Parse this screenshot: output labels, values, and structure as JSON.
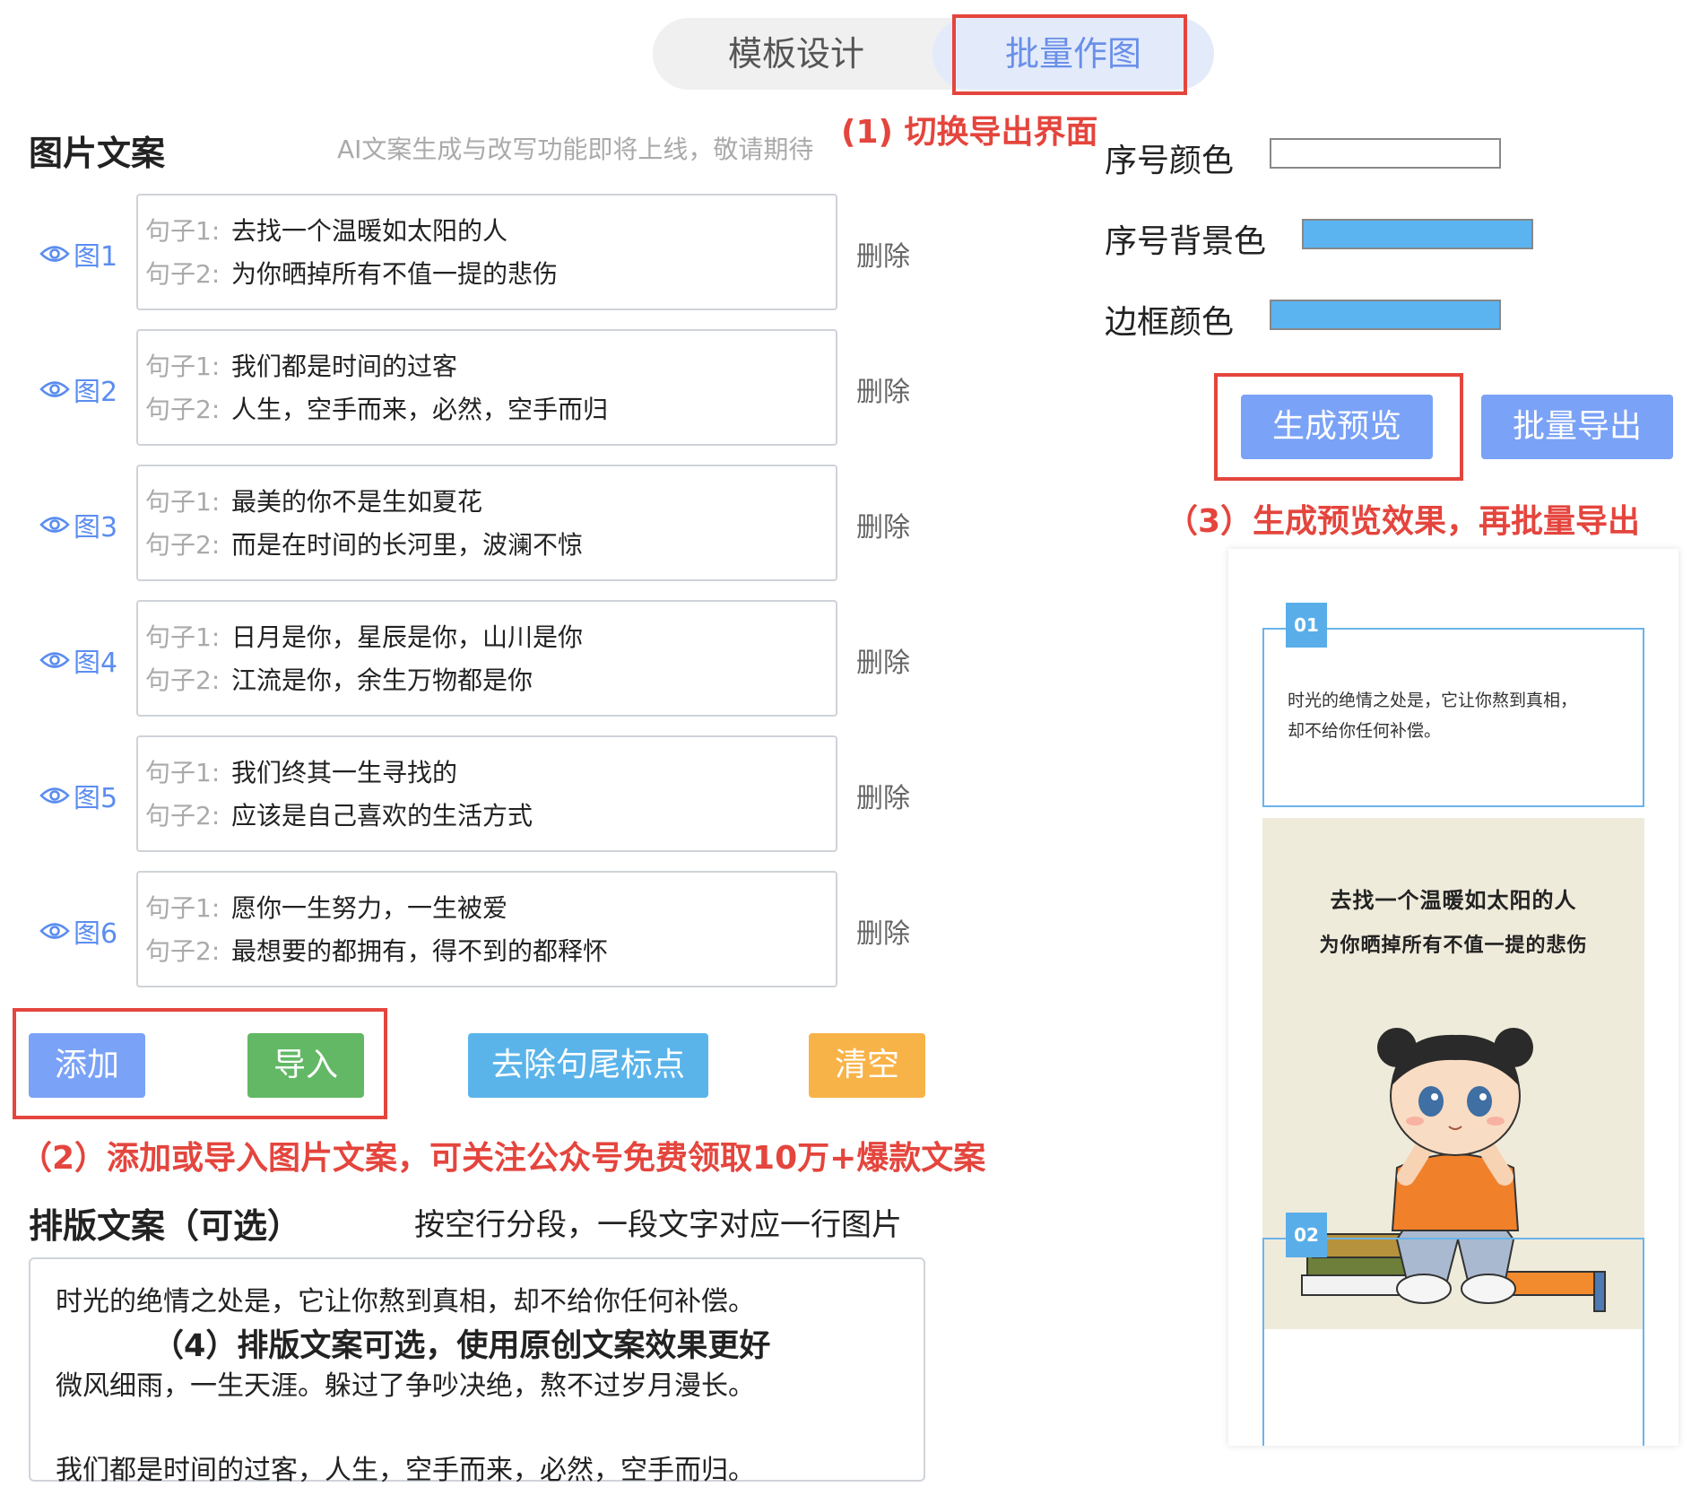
{
  "tabs": {
    "design": "模板设计",
    "batch": "批量作图"
  },
  "notes": {
    "n1": "(1) 切换导出界面",
    "n2": "（2）添加或导入图片文案，可关注公众号免费领取10万+爆款文案",
    "n3": "（3）生成预览效果，再批量导出",
    "n4": "（4）排版文案可选，使用原创文案效果更好"
  },
  "image_copy": {
    "title": "图片文案",
    "hint": "AI文案生成与改写功能即将上线，敬请期待",
    "sentence1_label": "句子1:",
    "sentence2_label": "句子2:",
    "delete_label": "删除",
    "rows": [
      {
        "view": "图1",
        "s1": "去找一个温暖如太阳的人",
        "s2": "为你晒掉所有不值一提的悲伤"
      },
      {
        "view": "图2",
        "s1": "我们都是时间的过客",
        "s2": "人生，空手而来，必然，空手而归"
      },
      {
        "view": "图3",
        "s1": "最美的你不是生如夏花",
        "s2": "而是在时间的长河里，波澜不惊"
      },
      {
        "view": "图4",
        "s1": "日月是你，星辰是你，山川是你",
        "s2": "江流是你，余生万物都是你"
      },
      {
        "view": "图5",
        "s1": "我们终其一生寻找的",
        "s2": "应该是自己喜欢的生活方式"
      },
      {
        "view": "图6",
        "s1": "愿你一生努力，一生被爱",
        "s2": "最想要的都拥有，得不到的都释怀"
      }
    ]
  },
  "buttons": {
    "add": "添加",
    "import": "导入",
    "strip": "去除句尾标点",
    "clear": "清空",
    "preview": "生成预览",
    "export": "批量导出"
  },
  "layout_copy": {
    "title": "排版文案（可选）",
    "hint": "按空行分段，一段文字对应一行图片",
    "p1": "时光的绝情之处是，它让你熬到真相，却不给你任何补偿。",
    "p2": "微风细雨，一生天涯。躲过了争吵决绝，熬不过岁月漫长。",
    "p3": "我们都是时间的过客，人生，空手而来，必然，空手而归。"
  },
  "settings": {
    "num_color_label": "序号颜色",
    "num_color": "#ffffff",
    "num_bg_label": "序号背景色",
    "num_bg": "#5bb4f0",
    "border_label": "边框颜色",
    "border_color": "#5bb4f0"
  },
  "preview": {
    "badge1": "01",
    "quote_line1": "时光的绝情之处是，它让你熬到真相，",
    "quote_line2": "却不给你任何补偿。",
    "img_line1": "去找一个温暖如太阳的人",
    "img_line2": "为你晒掉所有不值一提的悲伤",
    "badge2": "02"
  }
}
